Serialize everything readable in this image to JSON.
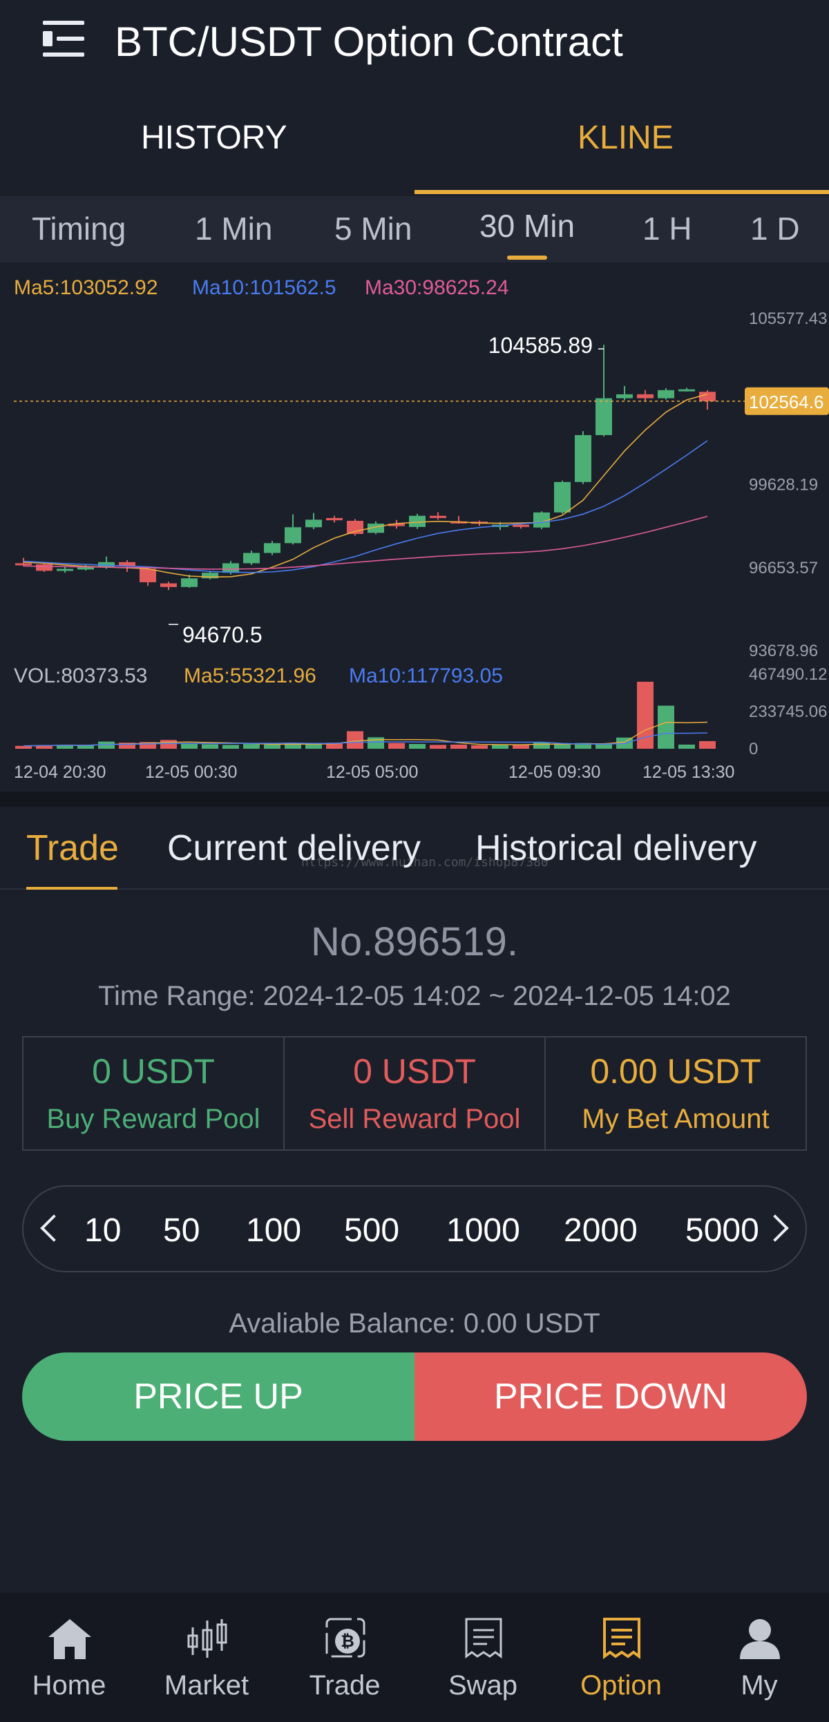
{
  "header": {
    "title": "BTC/USDT Option Contract",
    "menu_icon": "menu-icon"
  },
  "top_tabs": [
    {
      "label": "HISTORY",
      "active": false
    },
    {
      "label": "KLINE",
      "active": true
    }
  ],
  "intervals": [
    "Timing",
    "1 Min",
    "5 Min",
    "30 Min",
    "1 H",
    "1 D"
  ],
  "active_interval": "30 Min",
  "colors": {
    "accent": "#e8ad3d",
    "up": "#4caf76",
    "down": "#e25c5c",
    "ma5": "#e8ad3d",
    "ma10": "#4a7cf0",
    "ma30": "#e05c9a"
  },
  "chart_data": {
    "type": "candlestick",
    "price_indicators": {
      "ma5": "Ma5:103052.92",
      "ma10": "Ma10:101562.5",
      "ma30": "Ma30:98625.24"
    },
    "price_axis_ticks": [
      "105577.43",
      "99628.19",
      "96653.57",
      "93678.96"
    ],
    "price_axis_tick_values": [
      105577.43,
      99628.19,
      96653.57,
      93678.96
    ],
    "current_price_label": "102564.6",
    "current_price": 102564.6,
    "high_label": "104585.89",
    "high_value": 104585.89,
    "low_label": "94670.5",
    "low_value": 94670.5,
    "candles": [
      {
        "o": 96760,
        "c": 96740,
        "h": 96950,
        "l": 96650
      },
      {
        "o": 96720,
        "c": 96490,
        "h": 96780,
        "l": 96450
      },
      {
        "o": 96490,
        "c": 96560,
        "h": 96650,
        "l": 96420
      },
      {
        "o": 96540,
        "c": 96610,
        "h": 96700,
        "l": 96500
      },
      {
        "o": 96610,
        "c": 96800,
        "h": 97000,
        "l": 96560
      },
      {
        "o": 96800,
        "c": 96660,
        "h": 96870,
        "l": 96450
      },
      {
        "o": 96560,
        "c": 96080,
        "h": 96600,
        "l": 95950
      },
      {
        "o": 96040,
        "c": 95910,
        "h": 96100,
        "l": 95800
      },
      {
        "o": 95910,
        "c": 96220,
        "h": 96350,
        "l": 95880
      },
      {
        "o": 96220,
        "c": 96420,
        "h": 96470,
        "l": 96180
      },
      {
        "o": 96420,
        "c": 96760,
        "h": 96840,
        "l": 96360
      },
      {
        "o": 96760,
        "c": 97130,
        "h": 97210,
        "l": 96700
      },
      {
        "o": 97130,
        "c": 97480,
        "h": 97560,
        "l": 97050
      },
      {
        "o": 97480,
        "c": 98050,
        "h": 98510,
        "l": 97430
      },
      {
        "o": 98050,
        "c": 98320,
        "h": 98560,
        "l": 97980
      },
      {
        "o": 98380,
        "c": 98300,
        "h": 98460,
        "l": 98220
      },
      {
        "o": 98280,
        "c": 97810,
        "h": 98340,
        "l": 97750
      },
      {
        "o": 97850,
        "c": 98180,
        "h": 98260,
        "l": 97800
      },
      {
        "o": 98180,
        "c": 98090,
        "h": 98310,
        "l": 98000
      },
      {
        "o": 98060,
        "c": 98460,
        "h": 98530,
        "l": 97990
      },
      {
        "o": 98460,
        "c": 98380,
        "h": 98590,
        "l": 98320
      },
      {
        "o": 98260,
        "c": 98250,
        "h": 98450,
        "l": 98180
      },
      {
        "o": 98250,
        "c": 98180,
        "h": 98290,
        "l": 98100
      },
      {
        "o": 98060,
        "c": 98140,
        "h": 98240,
        "l": 97950
      },
      {
        "o": 98140,
        "c": 98060,
        "h": 98220,
        "l": 98000
      },
      {
        "o": 98040,
        "c": 98580,
        "h": 98620,
        "l": 97980
      },
      {
        "o": 98580,
        "c": 99670,
        "h": 99720,
        "l": 98530
      },
      {
        "o": 99670,
        "c": 101350,
        "h": 101490,
        "l": 99600
      },
      {
        "o": 101350,
        "c": 102670,
        "h": 104585.89,
        "l": 101300
      },
      {
        "o": 102670,
        "c": 102810,
        "h": 103110,
        "l": 102600
      },
      {
        "o": 102810,
        "c": 102670,
        "h": 102960,
        "l": 102560
      },
      {
        "o": 102670,
        "c": 102960,
        "h": 103030,
        "l": 102620
      },
      {
        "o": 102960,
        "c": 102990,
        "h": 103040,
        "l": 102910
      },
      {
        "o": 102900,
        "c": 102564.6,
        "h": 102960,
        "l": 102260
      }
    ],
    "ma_series": [
      {
        "name": "Ma5",
        "values": [
          96800,
          96760,
          96700,
          96650,
          96620,
          96600,
          96560,
          96420,
          96300,
          96270,
          96280,
          96380,
          96620,
          96900,
          97320,
          97660,
          97900,
          98060,
          98180,
          98230,
          98260,
          98240,
          98200,
          98190,
          98200,
          98220,
          98480,
          99020,
          99900,
          100780,
          101530,
          102170,
          102610,
          102820
        ]
      },
      {
        "name": "Ma10",
        "values": [
          96830,
          96790,
          96750,
          96720,
          96690,
          96660,
          96630,
          96580,
          96520,
          96470,
          96440,
          96430,
          96450,
          96520,
          96640,
          96810,
          97000,
          97240,
          97460,
          97660,
          97830,
          97950,
          98040,
          98110,
          98170,
          98220,
          98330,
          98520,
          98800,
          99180,
          99640,
          100130,
          100630,
          101150
        ]
      },
      {
        "name": "Ma30",
        "values": [
          96660,
          96650,
          96640,
          96630,
          96620,
          96610,
          96600,
          96580,
          96560,
          96550,
          96550,
          96560,
          96580,
          96620,
          96670,
          96730,
          96790,
          96850,
          96910,
          96960,
          97010,
          97050,
          97090,
          97120,
          97150,
          97200,
          97280,
          97390,
          97530,
          97690,
          97860,
          98050,
          98240,
          98440
        ]
      }
    ],
    "volume_indicators": {
      "vol": "VOL:80373.53",
      "ma5": "Ma5:55321.96",
      "ma10": "Ma10:117793.05"
    },
    "volume_axis_ticks": [
      "467490.12",
      "233745.06",
      "0"
    ],
    "volume_axis_tick_values": [
      467490.12,
      233745.06,
      0
    ],
    "volumes": [
      18000,
      22000,
      25000,
      21000,
      45000,
      38000,
      42000,
      55000,
      32000,
      28000,
      24000,
      30000,
      27000,
      33000,
      30000,
      38000,
      110000,
      72000,
      36000,
      30000,
      24000,
      26000,
      22000,
      28000,
      25000,
      40000,
      30000,
      36000,
      28000,
      70000,
      420000,
      270000,
      26000,
      48000
    ],
    "x_labels": [
      "12-04 20:30",
      "12-05 00:30",
      "12-05 05:00",
      "12-05 09:30",
      "12-05 13:30"
    ]
  },
  "sub_tabs": [
    {
      "label": "Trade",
      "active": true
    },
    {
      "label": "Current delivery",
      "active": false
    },
    {
      "label": "Historical delivery",
      "active": false
    }
  ],
  "watermark": "https://www.huzhan.com/ishop87380",
  "round": {
    "number": "No.896519.",
    "time_range": "Time Range:  2024-12-05 14:02 ~ 2024-12-05 14:02"
  },
  "pools": [
    {
      "amount": "0 USDT",
      "label": "Buy Reward Pool"
    },
    {
      "amount": "0 USDT",
      "label": "Sell Reward Pool"
    },
    {
      "amount": "0.00 USDT",
      "label": "My Bet Amount"
    }
  ],
  "amount_options": [
    "10",
    "50",
    "100",
    "500",
    "1000",
    "2000",
    "5000"
  ],
  "balance": "Avaliable Balance:  0.00 USDT",
  "actions": {
    "up": "PRICE UP",
    "down": "PRICE DOWN"
  },
  "bottom_nav": [
    {
      "label": "Home",
      "icon": "home-icon",
      "active": false
    },
    {
      "label": "Market",
      "icon": "market-icon",
      "active": false
    },
    {
      "label": "Trade",
      "icon": "trade-icon",
      "active": false
    },
    {
      "label": "Swap",
      "icon": "swap-icon",
      "active": false
    },
    {
      "label": "Option",
      "icon": "option-icon",
      "active": true
    },
    {
      "label": "My",
      "icon": "user-icon",
      "active": false
    }
  ]
}
